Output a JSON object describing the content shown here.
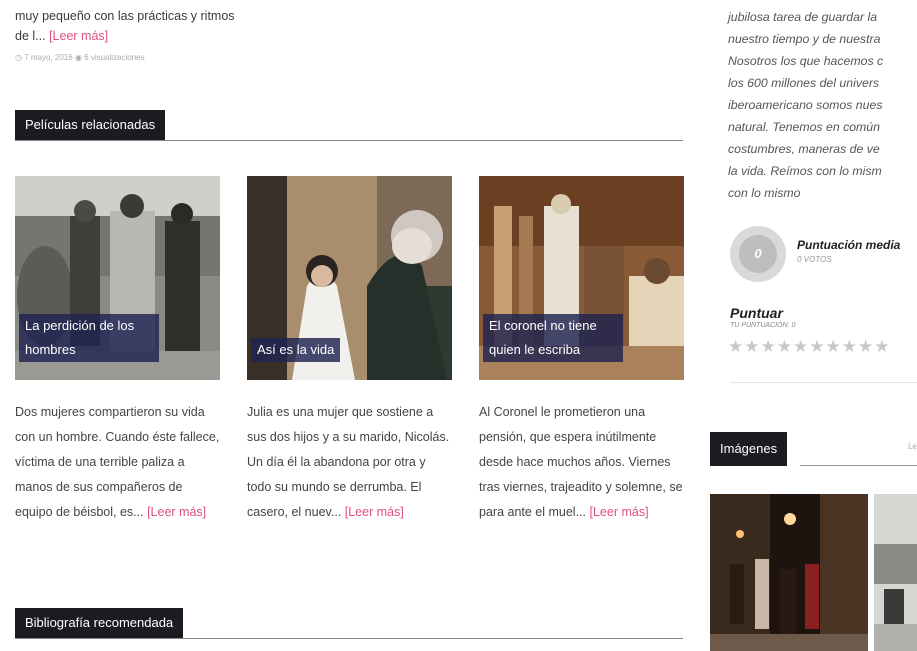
{
  "top_excerpt": {
    "text": "muy pequeño con las prácticas y ritmos de l...",
    "read_more": "[Leer más]",
    "date": "7 mayo, 2016",
    "views": "6 visualizaciones"
  },
  "related": {
    "heading": "Películas relacionadas",
    "items": [
      {
        "title": "La perdición de los hombres",
        "description": "Dos mujeres compartieron su vida con un hombre. Cuando éste fallece, víctima de una terrible paliza a manos de sus compañeros de equipo de béisbol, es...",
        "read_more": "[Leer más]"
      },
      {
        "title": "Así es la vida",
        "description": "Julia es una mujer que sostiene a sus dos hijos y a su marido, Nicolás. Un día él la abandona por otra y todo su mundo se derrumba. El casero, el nuev...",
        "read_more": "[Leer más]"
      },
      {
        "title": "El coronel no tiene quien le escriba",
        "description": "Al Coronel le prometieron una pensión, que espera inútilmente desde hace muchos años. Viernes tras viernes, trajeadito y solemne, se para ante el muel...",
        "read_more": "[Leer más]"
      }
    ]
  },
  "bibliography": {
    "heading": "Bibliografía recomendada"
  },
  "sidebar": {
    "quote_lines": [
      "jubilosa tarea de guardar la",
      "nuestro tiempo y de nuestra",
      "Nosotros los que hacemos c",
      "los 600 millones del univers",
      "iberoamericano somos nues",
      "natural. Tenemos en común",
      "costumbres, maneras de ve",
      "la vida. Reímos con lo mism",
      "con lo mismo"
    ],
    "rating": {
      "score": "0",
      "title": "Puntuación media",
      "votes": "0 VOTOS",
      "rate_label": "Puntuar",
      "your_rating": "TU PUNTUACIÓN: 0",
      "stars": 10
    },
    "images": {
      "heading": "Imágenes",
      "more": "Le"
    }
  },
  "colors": {
    "accent": "#e0507a",
    "heading_bg": "#1e1a22",
    "overlay": "#1e2350"
  }
}
